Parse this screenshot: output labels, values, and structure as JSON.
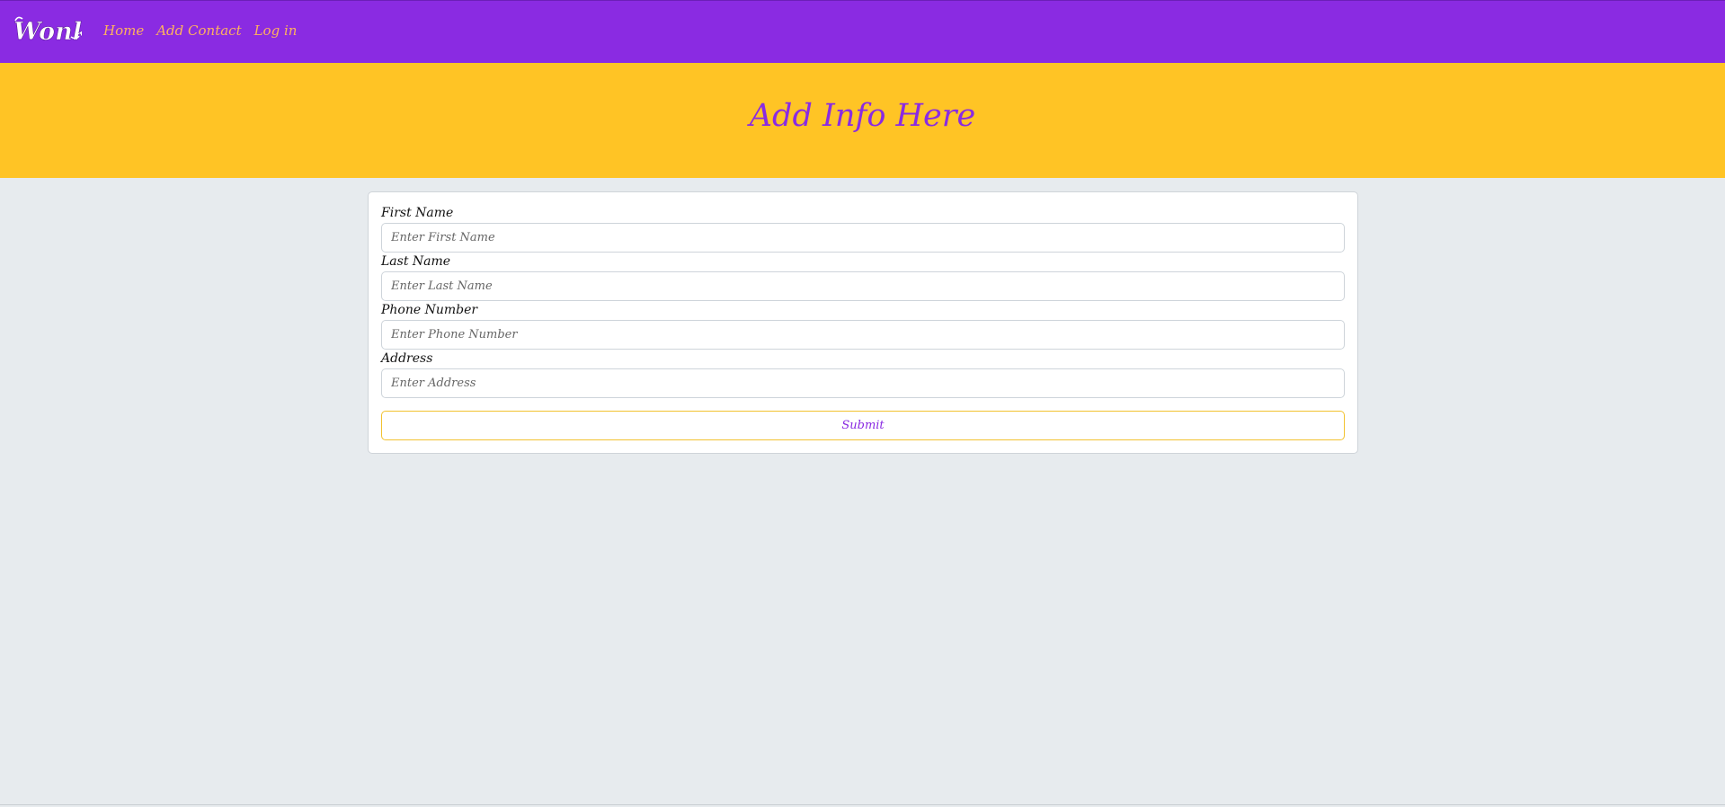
{
  "navbar": {
    "logo_text": "Wonka",
    "links": [
      {
        "label": "Home"
      },
      {
        "label": "Add Contact"
      },
      {
        "label": "Log in"
      }
    ]
  },
  "hero": {
    "title": "Add Info Here"
  },
  "form": {
    "fields": [
      {
        "label": "First Name",
        "placeholder": "Enter First Name",
        "value": ""
      },
      {
        "label": "Last Name",
        "placeholder": "Enter Last Name",
        "value": ""
      },
      {
        "label": "Phone Number",
        "placeholder": "Enter Phone Number",
        "value": ""
      },
      {
        "label": "Address",
        "placeholder": "Enter Address",
        "value": ""
      }
    ],
    "submit_label": "Submit"
  },
  "colors": {
    "navbar_bg": "#8a2be2",
    "nav_link": "#ffb25e",
    "hero_bg": "#ffc425",
    "accent": "#8a2be2",
    "page_bg": "#e7ebee",
    "button_border": "#f2c230"
  },
  "icons": {
    "logo": "wonka-logo"
  }
}
